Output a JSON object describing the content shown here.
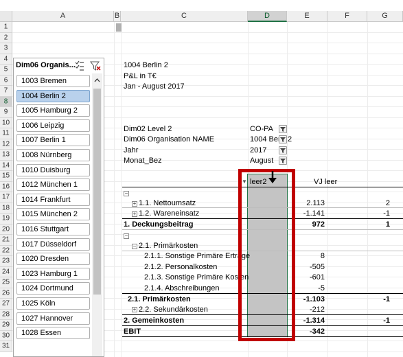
{
  "columns": [
    "A",
    "B",
    "C",
    "D",
    "E",
    "F",
    "G"
  ],
  "rows": [
    "1",
    "2",
    "3",
    "4",
    "5",
    "6",
    "7",
    "8",
    "9",
    "10",
    "11",
    "12",
    "13",
    "14",
    "15",
    "16",
    "17",
    "18",
    "19",
    "20",
    "21",
    "22",
    "23",
    "24",
    "25",
    "26",
    "27",
    "28",
    "29",
    "30",
    "31"
  ],
  "slicer": {
    "title": "Dim06 Organis...",
    "items": [
      "1003 Bremen",
      "1004 Berlin 2",
      "1005 Hamburg 2",
      "1006 Leipzig",
      "1007 Berlin 1",
      "1008 Nürnberg",
      "1010 Duisburg",
      "1012 München 1",
      "1014 Frankfurt",
      "1015 München 2",
      "1016 Stuttgart",
      "1017 Düsseldorf",
      "1020 Dresden",
      "1023 Hamburg 1",
      "1024 Dortmund",
      "1025 Köln",
      "1027 Hannover",
      "1028 Essen"
    ],
    "selected_index": 1,
    "multiselect_icon": "multi-select-icon",
    "clear_filter_icon": "clear-filter-icon"
  },
  "report": {
    "header_line1": "1004 Berlin 2",
    "header_line2": "P&L in T€",
    "header_line3": "Jan - August 2017",
    "filters": [
      {
        "label": "Dim02 Level 2",
        "value": "CO-PA"
      },
      {
        "label": "Dim06 Organisation NAME",
        "value": "1004 Ber",
        "suffix": "2"
      },
      {
        "label": "Jahr",
        "value": "2017"
      },
      {
        "label": "Monat_Bez",
        "value": "August"
      }
    ],
    "col_headers": {
      "d": "leer2",
      "e": "VJ leer"
    },
    "lines": [
      {
        "label": "1.1. Nettoumsatz",
        "e": "2.113",
        "g": "2"
      },
      {
        "label": "1.2. Wareneinsatz",
        "e": "-1.141",
        "g": "-1"
      },
      {
        "label": "1. Deckungsbeitrag",
        "e": "972",
        "g": "1"
      },
      {
        "label": "2.1. Primärkosten",
        "e": "",
        "g": ""
      },
      {
        "label": "2.1.1. Sonstige Primäre Erträge",
        "e": "8",
        "g": ""
      },
      {
        "label": "2.1.2. Personalkosten",
        "e": "-505",
        "g": ""
      },
      {
        "label": "2.1.3. Sonstige Primäre Kosten",
        "e": "-601",
        "g": ""
      },
      {
        "label": "2.1.4. Abschreibungen",
        "e": "-5",
        "g": ""
      },
      {
        "label": "2.1. Primärkosten",
        "e": "-1.103",
        "g": "-1"
      },
      {
        "label": "2.2. Sekundärkosten",
        "e": "-212",
        "g": ""
      },
      {
        "label": "2. Gemeinkosten",
        "e": "-1.314",
        "g": "-1"
      },
      {
        "label": "EBIT",
        "e": "-342",
        "g": ""
      }
    ]
  },
  "colors": {
    "accent": "#217346",
    "highlight_box": "#c00000",
    "selected_item": "#b9d1ec"
  }
}
